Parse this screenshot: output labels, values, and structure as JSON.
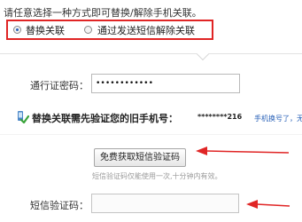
{
  "intro_text": "请任意选择一种方式即可替换/解除手机关联。",
  "options": [
    {
      "label": "替换关联",
      "checked": true
    },
    {
      "label": "通过发送短信解除关联",
      "checked": false
    }
  ],
  "password_field": {
    "label": "通行证密码：",
    "value": "••••••••••••"
  },
  "verify_hint": {
    "text": "替换关联需先验证您的旧手机号：",
    "phone_masked": "********216",
    "link_text": "手机换号了，无"
  },
  "sms_button": {
    "label": "免费获取短信验证码",
    "note": "短信验证码仅能使用一次,十分钟内有效。"
  },
  "code_field": {
    "label": "短信验证码：",
    "value": ""
  },
  "colors": {
    "highlight_border": "#e02525",
    "annotation_arrow": "#e02525",
    "link": "#2a62b8"
  }
}
